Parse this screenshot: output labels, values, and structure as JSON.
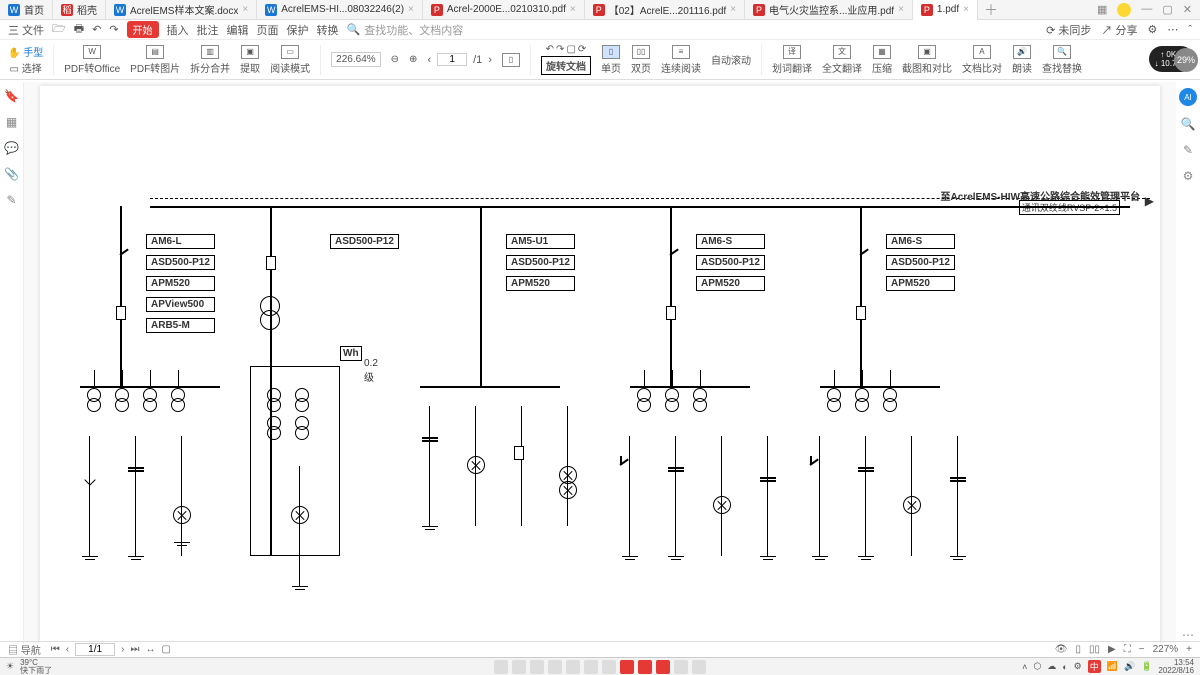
{
  "tabs": [
    {
      "label": "首页",
      "icon": "blue"
    },
    {
      "label": "稻壳",
      "icon": "red"
    },
    {
      "label": "AcrelEMS样本文案.docx",
      "icon": "blue"
    },
    {
      "label": "AcrelEMS-HI...08032246(2)",
      "icon": "blue"
    },
    {
      "label": "Acrel-2000E...0210310.pdf",
      "icon": "red"
    },
    {
      "label": "【02】AcrelE...201116.pdf",
      "icon": "red"
    },
    {
      "label": "电气火灾监控系...业应用.pdf",
      "icon": "red"
    },
    {
      "label": "1.pdf",
      "icon": "red",
      "active": true
    }
  ],
  "menu": {
    "file": "三 文件",
    "start": "开始",
    "insert": "插入",
    "annotate": "批注",
    "edit": "编辑",
    "page": "页面",
    "protect": "保护",
    "convert": "转换",
    "search_ph": "查找功能、文档内容",
    "right_sync": "未同步",
    "right_share": "分享"
  },
  "ribbon": {
    "hand": "手型",
    "select": "选择",
    "toOffice": "PDF转Office",
    "toImg": "PDF转图片",
    "split": "拆分合并",
    "extract": "提取",
    "readmode": "阅读模式",
    "zoom": "226.64%",
    "page_cur": "1",
    "page_total": "/1",
    "rotate": "旋转文档",
    "single": "单页",
    "double": "双页",
    "continuous": "连续阅读",
    "autoscroll": "自动滚动",
    "trans": "划词翻译",
    "fulltrans": "全文翻译",
    "compress": "压缩",
    "compare": "截图和对比",
    "docdiff": "文档比对",
    "read": "朗读",
    "replace": "查找替换"
  },
  "net": {
    "up": "0K/s",
    "down": "10.7K/s",
    "pct": "29%"
  },
  "diagram": {
    "platform": "至AcrelEMS-HIW高速公路综合能效管理平台",
    "protocol": "通讯双绞线RVSP-2×1.5",
    "wh": "Wh",
    "whclass": "0.2 级",
    "col1": [
      "AM6-L",
      "ASD500-P12",
      "APM520",
      "APView500",
      "ARB5-M"
    ],
    "col2": [
      "ASD500-P12"
    ],
    "col3": [
      "AM5-U1",
      "ASD500-P12",
      "APM520"
    ],
    "col4": [
      "AM6-S",
      "ASD500-P12",
      "APM520"
    ],
    "col5": [
      "AM6-S",
      "ASD500-P12",
      "APM520"
    ]
  },
  "status": {
    "nav": "导航",
    "page_cur": "1/1",
    "zoom": "227%"
  },
  "taskbar": {
    "temp": "39°C",
    "weather": "快下雨了",
    "ime": "中",
    "time": "13:54",
    "date": "2022/8/16"
  }
}
